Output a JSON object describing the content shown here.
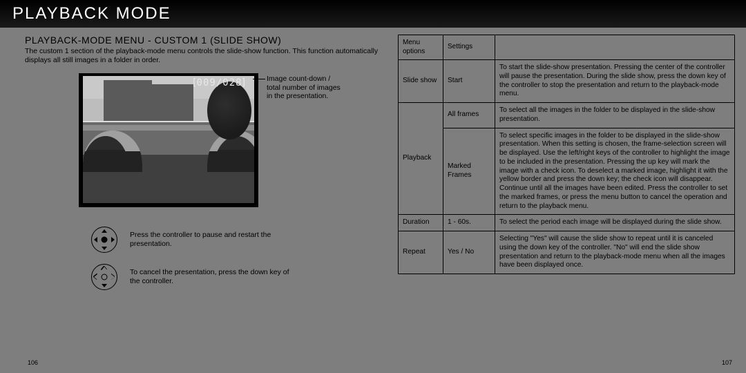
{
  "header": {
    "title": "PLAYBACK MODE"
  },
  "left": {
    "subhead": "PLAYBACK-MODE MENU - CUSTOM 1 (SLIDE SHOW)",
    "intro": "The custom 1 section of the playback-mode menu controls the slide-show function. This function automatically displays all still images in a folder in order.",
    "counter": "009/028",
    "counter_caption": "Image count-down / total number of images in the presentation.",
    "ctrl1": "Press the controller to pause and restart the presentation.",
    "ctrl2": "To cancel the presentation, press the down key of the controller.",
    "page_left": "106"
  },
  "right": {
    "head_a": "Menu options",
    "head_b": "Settings",
    "rows": [
      {
        "opt": "Slide show",
        "set": "Start",
        "desc": "To start the slide-show presentation. Pressing the center of the controller will pause the presentation. During the slide show, press the down key of the controller to stop the presentation and return to the playback-mode menu."
      },
      {
        "opt": "Playback",
        "set": "All frames",
        "desc": "To select all the images in the folder to be displayed in the slide-show presentation."
      },
      {
        "opt": "",
        "set": "Marked Frames",
        "desc": "To select specific images in the folder to be displayed in the slide-show presentation. When this setting is chosen, the frame-selection screen will be displayed. Use the left/right keys of the controller to highlight the image to be included in the presentation. Pressing the up key will mark the image with a check icon. To deselect a marked image, highlight it with the yellow border and press the down key; the check icon will disappear. Continue until all the images have been edited. Press the controller to set the marked frames, or press the menu button to cancel the operation and return to the playback menu."
      },
      {
        "opt": "Duration",
        "set": "1 - 60s.",
        "desc": "To select the period each image will be displayed during the slide show."
      },
      {
        "opt": "Repeat",
        "set": "Yes / No",
        "desc": "Selecting \"Yes\" will cause the slide show to repeat until it is canceled using the down key of the controller. \"No\" will end the slide show presentation and return to the playback-mode menu when all the images have been displayed once."
      }
    ],
    "page_right": "107"
  }
}
